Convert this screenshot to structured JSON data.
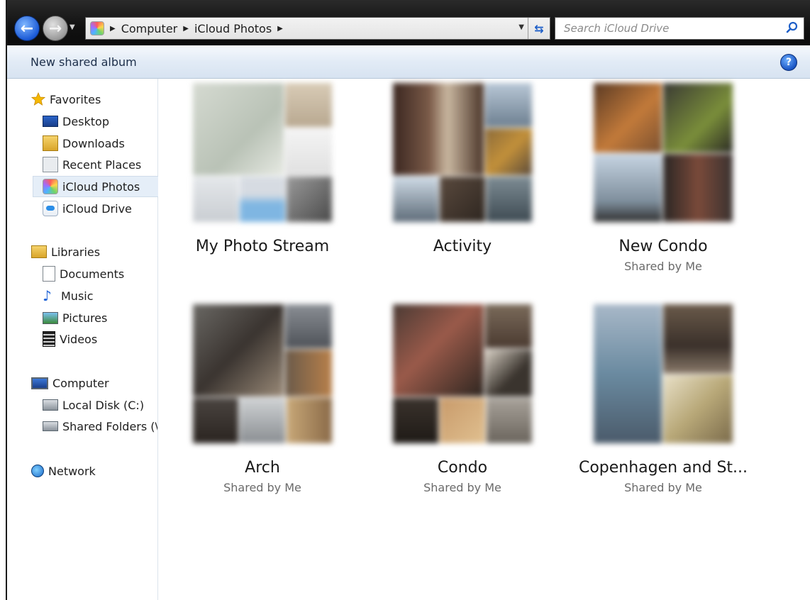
{
  "address": {
    "path": [
      "Computer",
      "iCloud Photos"
    ]
  },
  "search": {
    "placeholder": "Search iCloud Drive"
  },
  "toolbar": {
    "new_shared_album": "New shared album"
  },
  "sidebar": {
    "favorites": {
      "label": "Favorites",
      "items": [
        {
          "label": "Desktop",
          "icon": "desktop-icon"
        },
        {
          "label": "Downloads",
          "icon": "downloads-icon"
        },
        {
          "label": "Recent Places",
          "icon": "recent-places-icon"
        },
        {
          "label": "iCloud Photos",
          "icon": "icloud-photos-icon",
          "selected": true
        },
        {
          "label": "iCloud Drive",
          "icon": "icloud-drive-icon"
        }
      ]
    },
    "libraries": {
      "label": "Libraries",
      "items": [
        {
          "label": "Documents",
          "icon": "documents-icon"
        },
        {
          "label": "Music",
          "icon": "music-icon"
        },
        {
          "label": "Pictures",
          "icon": "pictures-icon"
        },
        {
          "label": "Videos",
          "icon": "videos-icon"
        }
      ]
    },
    "computer": {
      "label": "Computer",
      "items": [
        {
          "label": "Local Disk (C:)",
          "icon": "local-disk-icon"
        },
        {
          "label": "Shared Folders (\\",
          "icon": "shared-folders-icon"
        }
      ]
    },
    "network": {
      "label": "Network"
    }
  },
  "albums": [
    {
      "name": "My Photo Stream",
      "subtitle": ""
    },
    {
      "name": "Activity",
      "subtitle": ""
    },
    {
      "name": "New Condo",
      "subtitle": "Shared by Me"
    },
    {
      "name": "Arch",
      "subtitle": "Shared by Me"
    },
    {
      "name": "Condo",
      "subtitle": "Shared by Me"
    },
    {
      "name": "Copenhagen and St...",
      "subtitle": "Shared by Me"
    }
  ],
  "colors": {
    "titlebar": "#111111",
    "toolbar": "#e2ebf6",
    "selection": "#e5eef8",
    "accent": "#1a55c4"
  }
}
